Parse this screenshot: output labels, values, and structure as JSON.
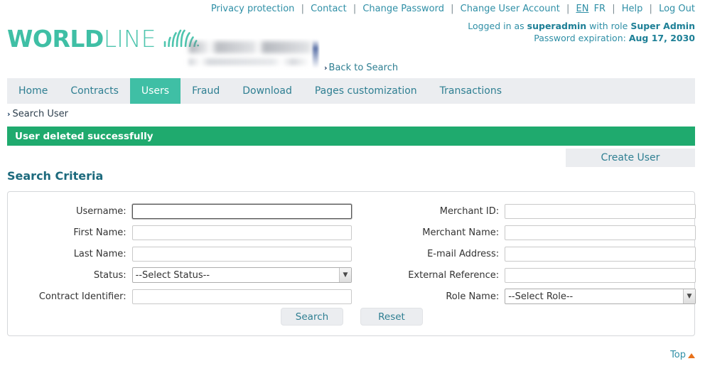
{
  "topbar": {
    "links": [
      {
        "label": "Privacy protection"
      },
      {
        "label": "Contact"
      },
      {
        "label": "Change Password"
      },
      {
        "label": "Change User Account"
      }
    ],
    "lang_active": "EN",
    "lang_inactive": "FR",
    "help": "Help",
    "logout": "Log Out",
    "separator": "|"
  },
  "session": {
    "logged_prefix": "Logged in as ",
    "username": "superadmin",
    "role_prefix": " with role ",
    "role": "Super Admin",
    "pwd_prefix": "Password expiration: ",
    "pwd_date": "Aug 17, 2030"
  },
  "brand": {
    "name_bold": "WORLD",
    "name_light": "LINE",
    "accent": "#3fbfa5"
  },
  "back_link": {
    "chevron": "›",
    "label": "Back to Search"
  },
  "nav": {
    "items": [
      {
        "label": "Home",
        "active": false
      },
      {
        "label": "Contracts",
        "active": false
      },
      {
        "label": "Users",
        "active": true
      },
      {
        "label": "Fraud",
        "active": false
      },
      {
        "label": "Download",
        "active": false
      },
      {
        "label": "Pages customization",
        "active": false
      },
      {
        "label": "Transactions",
        "active": false
      }
    ],
    "active_bg": "#3fbfa5",
    "bar_bg": "#ebedf0"
  },
  "breadcrumb": {
    "chevron": "›",
    "label": "Search User"
  },
  "banner": {
    "message": "User deleted successfully",
    "color": "#1faa6e"
  },
  "toolbar": {
    "create_user_label": "Create User"
  },
  "section": {
    "title": "Search Criteria"
  },
  "form": {
    "left": [
      {
        "label": "Username:",
        "type": "text",
        "value": "",
        "placeholder": "",
        "focused": true
      },
      {
        "label": "First Name:",
        "type": "text",
        "value": "",
        "placeholder": "",
        "focused": false
      },
      {
        "label": "Last Name:",
        "type": "text",
        "value": "",
        "placeholder": "",
        "focused": false
      },
      {
        "label": "Status:",
        "type": "select",
        "value": "--Select Status--",
        "placeholder": "",
        "focused": false
      },
      {
        "label": "Contract Identifier:",
        "type": "text",
        "value": "",
        "placeholder": "",
        "focused": false
      }
    ],
    "right": [
      {
        "label": "Merchant ID:",
        "type": "text",
        "value": "",
        "placeholder": "",
        "focused": false
      },
      {
        "label": "Merchant Name:",
        "type": "text",
        "value": "",
        "placeholder": "",
        "focused": false
      },
      {
        "label": "E-mail Address:",
        "type": "text",
        "value": "",
        "placeholder": "",
        "focused": false
      },
      {
        "label": "External Reference:",
        "type": "text",
        "value": "",
        "placeholder": "",
        "focused": false
      },
      {
        "label": "Role Name:",
        "type": "select",
        "value": "--Select Role--",
        "placeholder": "",
        "focused": false
      }
    ],
    "search_label": "Search",
    "reset_label": "Reset"
  },
  "footer": {
    "top_label": "Top",
    "top_triangle_color": "#e8711a"
  }
}
